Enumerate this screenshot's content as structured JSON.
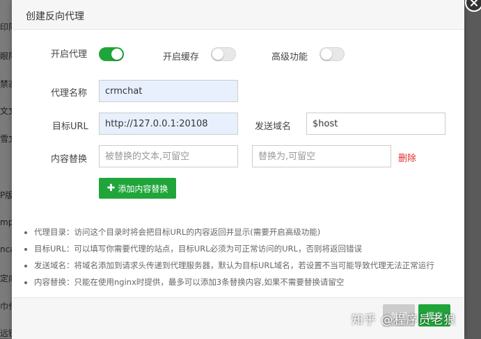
{
  "background": {
    "sidebar_items": [
      "印限",
      "眼限",
      "禁态",
      "文文",
      "雪文",
      "P版",
      "mpo",
      "nca",
      "定向",
      "巾代",
      "远链"
    ]
  },
  "dialog": {
    "title": "创建反向代理",
    "toggles": [
      {
        "label": "开启代理",
        "on": true
      },
      {
        "label": "开启缓存",
        "on": false
      },
      {
        "label": "高级功能",
        "on": false
      }
    ],
    "proxy_name": {
      "label": "代理名称",
      "value": "crmchat"
    },
    "target_url": {
      "label": "目标URL",
      "value": "http://127.0.0.1:20108"
    },
    "send_domain": {
      "label": "发送域名",
      "value": "$host"
    },
    "content_replace": {
      "label": "内容替换",
      "from_placeholder": "被替换的文本,可留空",
      "to_placeholder": "替换为,可留空",
      "delete_label": "删除"
    },
    "add_replace_button": "添加内容替换",
    "notes": [
      "代理目录：访问这个目录时将会把目标URL的内容返回并显示(需要开启高级功能)",
      "目标URL：可以填写你需要代理的站点，目标URL必须为可正常访问的URL，否则将返回错误",
      "发送域名：将域名添加到请求头传递到代理服务器，默认为目标URL域名，若设置不当可能导致代理无法正常运行",
      "内容替换：只能在使用nginx时提供，最多可以添加3条替换内容,如果不需要替换请留空"
    ],
    "footer": {
      "close_label": "关闭",
      "submit_label": "提交"
    }
  },
  "watermark": "知乎 @程序员老狼",
  "colors": {
    "accent": "#20a53a",
    "danger": "#e02e2e",
    "autofill": "#e8f0fe"
  }
}
